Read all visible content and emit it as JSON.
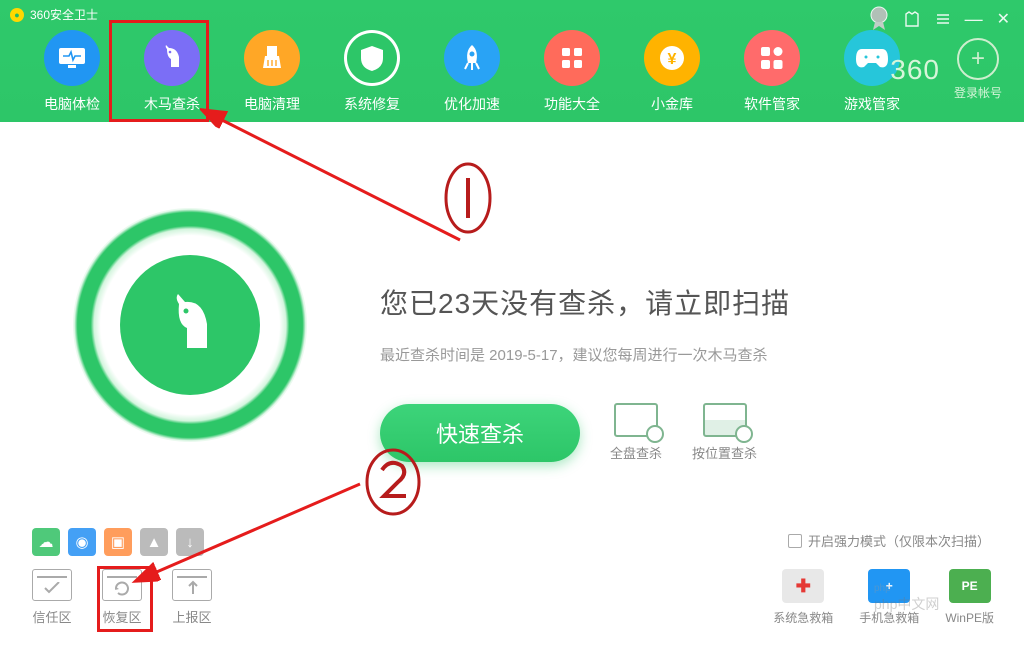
{
  "titlebar": {
    "title": "360安全卫士"
  },
  "nav": [
    {
      "label": "电脑体检"
    },
    {
      "label": "木马查杀"
    },
    {
      "label": "电脑清理"
    },
    {
      "label": "系统修复"
    },
    {
      "label": "优化加速"
    },
    {
      "label": "功能大全"
    },
    {
      "label": "小金库"
    },
    {
      "label": "软件管家"
    },
    {
      "label": "游戏管家"
    }
  ],
  "login": {
    "logo": "360",
    "label": "登录帐号"
  },
  "main": {
    "headline": "您已23天没有查杀，请立即扫描",
    "subline": "最近查杀时间是 2019-5-17，建议您每周进行一次木马查杀",
    "scan_button": "快速查杀",
    "full_scan": "全盘查杀",
    "loc_scan": "按位置查杀"
  },
  "footer": {
    "tools": [
      {
        "label": "信任区"
      },
      {
        "label": "恢复区"
      },
      {
        "label": "上报区"
      }
    ],
    "strong_mode": "开启强力模式（仅限本次扫描）",
    "kits": [
      {
        "label": "系统急救箱",
        "icon_text": "✚"
      },
      {
        "label": "手机急救箱",
        "icon_text": "+"
      },
      {
        "label": "WinPE版",
        "icon_text": "PE"
      }
    ]
  },
  "annotations": {
    "one": "1",
    "two": "2"
  },
  "watermark": "php中文网"
}
